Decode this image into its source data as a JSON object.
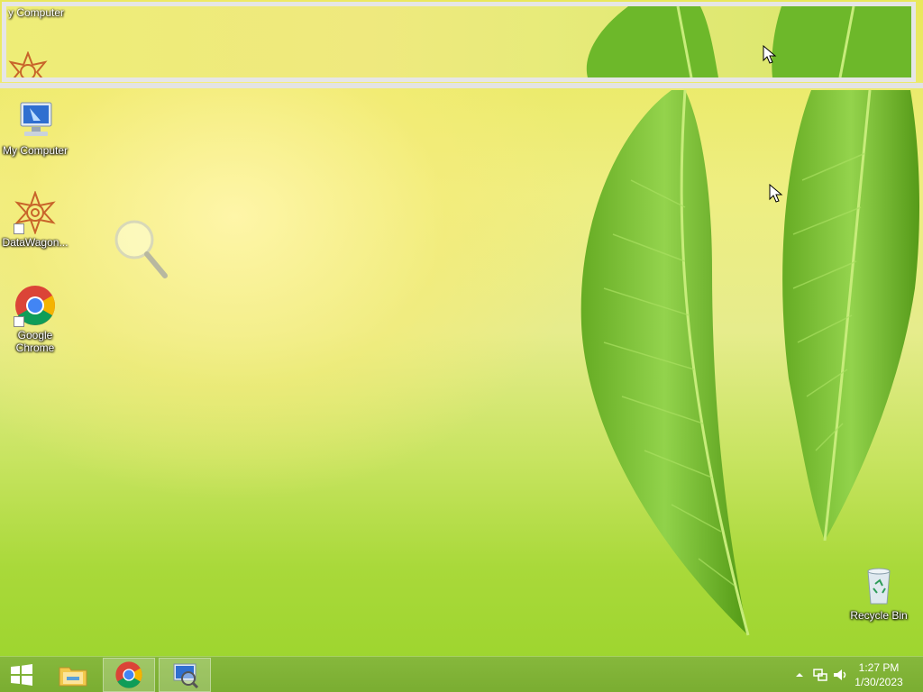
{
  "desktop": {
    "icons": [
      {
        "label": "My Computer",
        "icon": "computer-icon"
      },
      {
        "label": "DataWagon...",
        "icon": "datawagon-icon"
      },
      {
        "label": "Google Chrome",
        "icon": "chrome-icon"
      },
      {
        "label": "Recycle Bin",
        "icon": "recycle-bin-icon"
      }
    ]
  },
  "magnifier": {
    "label_fragment": "y Computer",
    "tool_icon": "magnifier-icon"
  },
  "taskbar": {
    "start_icon": "windows-logo-icon",
    "pinned": [
      {
        "name": "File Explorer",
        "icon": "folder-icon"
      },
      {
        "name": "Google Chrome",
        "icon": "chrome-icon"
      },
      {
        "name": "Magnifier",
        "icon": "computer-magnifier-icon"
      }
    ],
    "tray": {
      "show_hidden_icon": "chevron-up-icon",
      "network_icon": "network-icon",
      "volume_icon": "speaker-icon",
      "time": "1:27 PM",
      "date": "1/30/2023"
    }
  },
  "colors": {
    "taskbar": "#7aad31",
    "wallpaper_yellow": "#eeee82",
    "wallpaper_green": "#9ad42b"
  }
}
